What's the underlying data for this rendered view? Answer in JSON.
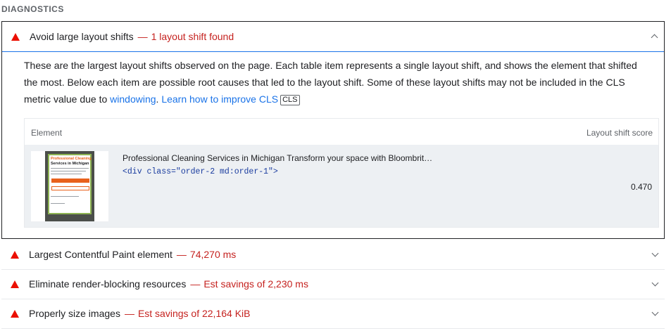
{
  "section": {
    "title": "DIAGNOSTICS"
  },
  "open_audit": {
    "title": "Avoid large layout shifts",
    "separator": "—",
    "display_value": "1 layout shift found",
    "description_1": "These are the largest layout shifts observed on the page. Each table item represents a single layout shift, and shows the element that shifted the most. Below each item are possible root causes that led to the layout shift. Some of these layout shifts may not be included in the CLS metric value due to ",
    "link_windowing": "windowing",
    "description_2": ". ",
    "link_learn": "Learn how to improve CLS",
    "badge": "CLS",
    "table": {
      "col_element": "Element",
      "col_score": "Layout shift score",
      "rows": [
        {
          "thumb_line1": "Professional Cleaning",
          "thumb_line2": "Services in Michigan",
          "node_label": "Professional Cleaning Services in Michigan Transform your space with Bloombrit…",
          "snippet": "<div class=\"order-2 md:order-1\">",
          "score": "0.470"
        }
      ]
    }
  },
  "audits": [
    {
      "title": "Largest Contentful Paint element",
      "separator": "—",
      "display_value": "74,270 ms"
    },
    {
      "title": "Eliminate render-blocking resources",
      "separator": "—",
      "display_value": "Est savings of 2,230 ms"
    },
    {
      "title": "Properly size images",
      "separator": "—",
      "display_value": "Est savings of 22,164 KiB"
    }
  ],
  "colors": {
    "fail": "#eb0f00",
    "fail_text": "#c5221f",
    "link": "#1a73e8",
    "focus_border": "#202124"
  },
  "icons": {
    "fail": "triangle-fail-icon",
    "expand": "chevron-down-icon",
    "collapse": "chevron-up-icon"
  }
}
